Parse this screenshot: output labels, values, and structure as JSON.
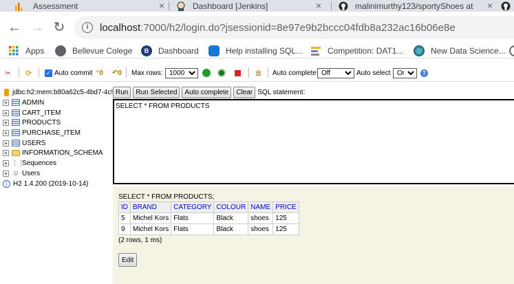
{
  "browser": {
    "tabs": [
      {
        "title": "Assessment",
        "icon": "analytics-icon"
      },
      {
        "title": "Dashboard [Jenkins]",
        "icon": "jenkins-icon"
      },
      {
        "title": "malinimurthy123/sportyShoes at",
        "icon": "github-icon"
      }
    ],
    "url_host": "localhost",
    "url_rest": ":7000/h2/login.do?jsessionid=8e97e9b2bccc04fdb8a232ac16b06e8e",
    "bookmarks": [
      "Apps",
      "Bellevue Colege",
      "Dashboard",
      "Help installing SQL...",
      "Competition: DAT1...",
      "New Data Science..."
    ]
  },
  "toolbar": {
    "auto_commit_label": "Auto commit",
    "max_rows_label": "Max rows:",
    "max_rows_value": "1000",
    "auto_complete_label": "Auto complete",
    "auto_complete_value": "Off",
    "auto_select_label": "Auto select",
    "auto_select_value": "On",
    "help_glyph": "?"
  },
  "tree": {
    "connection": "jdbc:h2:mem:b80a62c5-4bd7-4c!",
    "tables": [
      "ADMIN",
      "CART_ITEM",
      "PRODUCTS",
      "PURCHASE_ITEM",
      "USERS"
    ],
    "schema": "INFORMATION_SCHEMA",
    "sequences": "Sequences",
    "users": "Users",
    "version": "H2 1.4.200 (2019-10-14)"
  },
  "query": {
    "buttons": [
      "Run",
      "Run Selected",
      "Auto complete",
      "Clear"
    ],
    "label": "SQL statement:",
    "sql": "SELECT * FROM PRODUCTS"
  },
  "result": {
    "statement": "SELECT * FROM PRODUCTS;",
    "columns": [
      "ID",
      "BRAND",
      "CATEGORY",
      "COLOUR",
      "NAME",
      "PRICE"
    ],
    "rows": [
      [
        "5",
        "Michel Kors",
        "Flats",
        "Black",
        "shoes",
        "125"
      ],
      [
        "9",
        "Michel Kors",
        "Flats",
        "Black",
        "shoes",
        "125"
      ]
    ],
    "info": "(2 rows, 1 ms)",
    "edit_label": "Edit"
  },
  "colors": {
    "header_link": "#0000c8",
    "result_bg": "#f4f3e4"
  }
}
